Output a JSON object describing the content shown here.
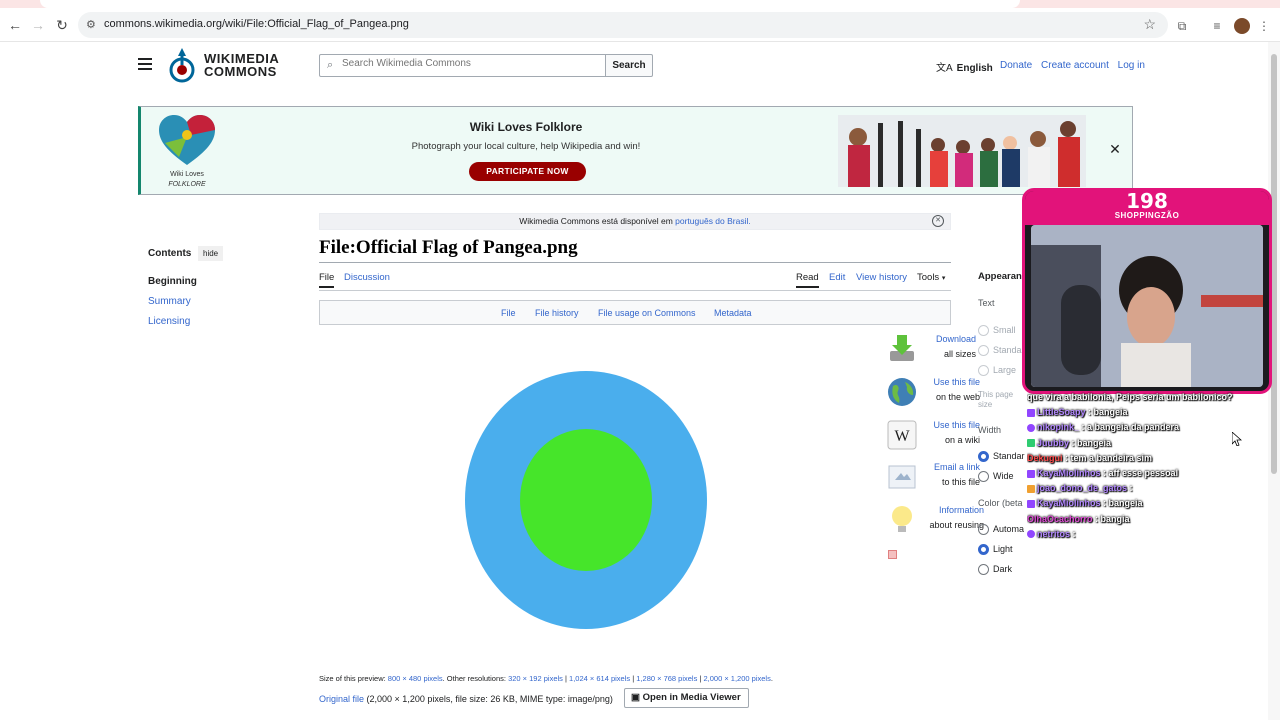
{
  "browser": {
    "url": "commons.wikimedia.org/wiki/File:Official_Flag_of_Pangea.png"
  },
  "header": {
    "logo_line1": "WIKIMEDIA",
    "logo_line2": "COMMONS",
    "search_placeholder": "Search Wikimedia Commons",
    "search_button": "Search",
    "language": "English",
    "links": [
      "Donate",
      "Create account",
      "Log in"
    ]
  },
  "banner": {
    "logo_text1": "Wiki Loves",
    "logo_text2": "FOLKLORE",
    "title": "Wiki Loves Folklore",
    "subtitle": "Photograph your local culture, help Wikipedia and win!",
    "button": "PARTICIPATE NOW"
  },
  "notice": {
    "text": "Wikimedia Commons está disponível em ",
    "link": "português do Brasil."
  },
  "toc": {
    "heading": "Contents",
    "hide": "hide",
    "items": [
      "Beginning",
      "Summary",
      "Licensing"
    ]
  },
  "page": {
    "title": "File:Official Flag of Pangea.png",
    "tabs_left": [
      "File",
      "Discussion"
    ],
    "tabs_right": [
      "Read",
      "Edit",
      "View history",
      "Tools"
    ],
    "file_toc": [
      "File",
      "File history",
      "File usage on Commons",
      "Metadata"
    ]
  },
  "flag": {
    "outer_color": "#4aaeed",
    "inner_color": "#46e52a"
  },
  "side_tools": [
    {
      "line1": "Download",
      "line2": "all sizes",
      "icon": "download-icon"
    },
    {
      "line1": "Use this file",
      "line2": "on the web",
      "icon": "globe-icon"
    },
    {
      "line1": "Use this file",
      "line2": "on a wiki",
      "icon": "wikipedia-icon"
    },
    {
      "line1": "Email a link",
      "line2": "to this file",
      "icon": "email-icon"
    },
    {
      "line1": "Information",
      "line2": "about reusing",
      "icon": "lightbulb-icon"
    }
  ],
  "appearance": {
    "heading": "Appearan",
    "text_label": "Text",
    "text_options": [
      "Small",
      "Standa",
      "Large"
    ],
    "page_note_1": "This page",
    "page_note_2": "size",
    "width_label": "Width",
    "width_options": [
      "Standar",
      "Wide"
    ],
    "color_label": "Color (beta",
    "color_options": [
      "Automa",
      "Light",
      "Dark"
    ]
  },
  "file_info": {
    "preview_label": "Size of this preview: ",
    "preview_size": "800 × 480 pixels",
    "other_label": ". Other resolutions: ",
    "resolutions": [
      "320 × 192 pixels",
      "1,024 × 614 pixels",
      "1,280 × 768 pixels",
      "2,000 × 1,200 pixels"
    ],
    "original_link": "Original file",
    "original_details": " (2,000 × 1,200 pixels, file size: 26 KB, MIME type: image/png)",
    "media_viewer_button": "Open in Media Viewer"
  },
  "stream": {
    "count": "198",
    "channel": "SHOPPINGZÃO",
    "chat": [
      {
        "user": "",
        "msg": "que vira a babilonia, Peips seria um babilonico?",
        "color": "#ffffff"
      },
      {
        "user": "LittleSoapy",
        "msg": ": bangeia",
        "color": "#b388ff"
      },
      {
        "user": "nikopink_",
        "msg": ": a bangeia da pandera",
        "color": "#b388ff"
      },
      {
        "user": "Juubby",
        "msg": ": bangeia",
        "color": "#b388ff"
      },
      {
        "user": "Dekugui",
        "msg": ": tem a bandeira sim",
        "color": "#ff4d4d"
      },
      {
        "user": "KayaMiolinhos",
        "msg": ": aff esse pessoal",
        "color": "#b388ff"
      },
      {
        "user": "joao_dono_de_gatos",
        "msg": ":",
        "color": "#b388ff"
      },
      {
        "user": "KayaMiolinhos",
        "msg": ": bangeia",
        "color": "#b388ff"
      },
      {
        "user": "OlhaOcachorro",
        "msg": ": bangia",
        "color": "#e24bd8"
      },
      {
        "user": "netritos",
        "msg": ":",
        "color": "#b388ff"
      }
    ]
  }
}
